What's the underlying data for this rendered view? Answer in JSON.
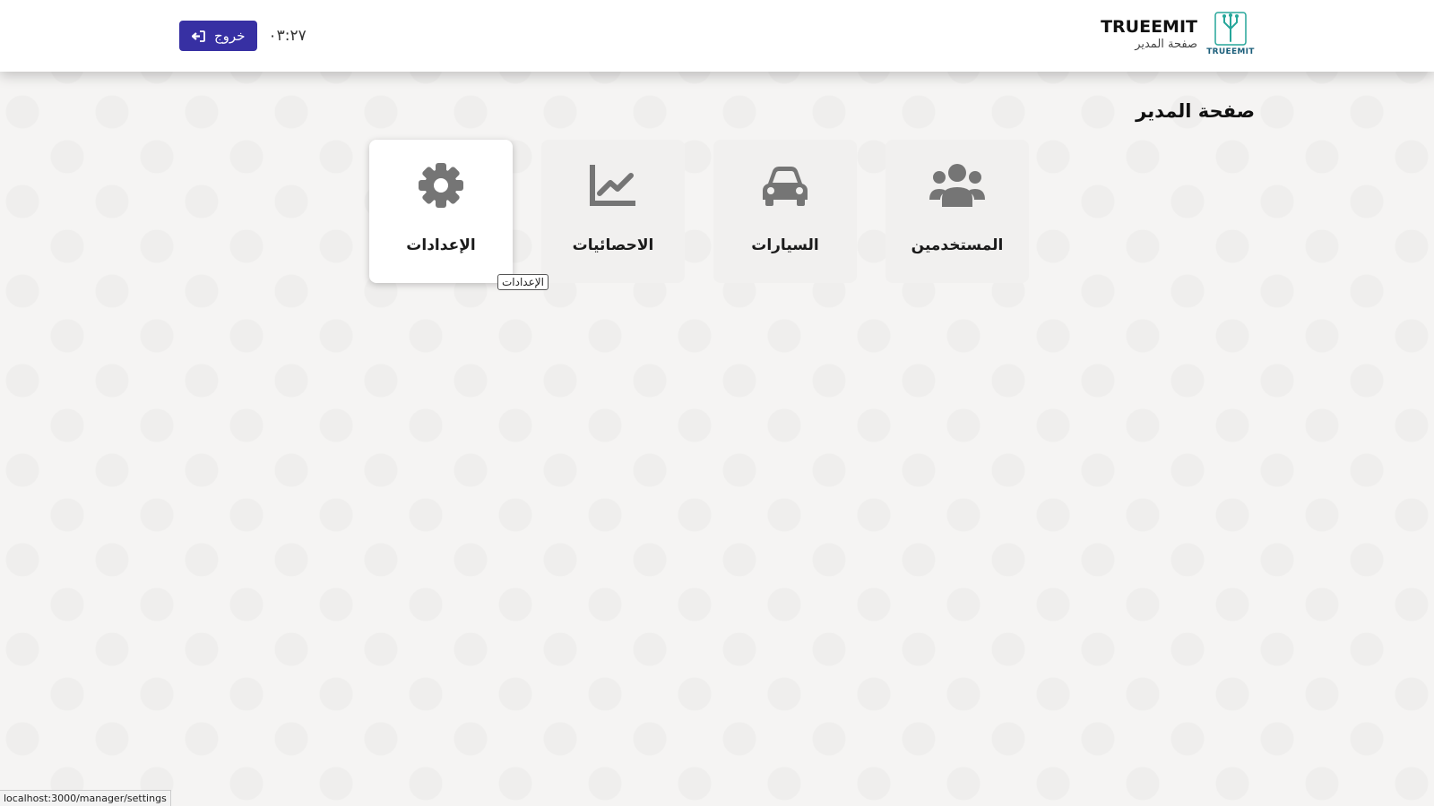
{
  "header": {
    "brand_name": "TRUEEMIT",
    "brand_subtitle": "صفحة المدير",
    "logo_text": "TRUEEMIT",
    "time": "٠٣:٢٧",
    "logout_label": "خروج"
  },
  "main": {
    "title": "صفحة المدير",
    "cards": [
      {
        "label": "المستخدمين",
        "icon": "users-icon"
      },
      {
        "label": "السيارات",
        "icon": "car-icon"
      },
      {
        "label": "الاحصائيات",
        "icon": "chart-line-icon"
      },
      {
        "label": "الإعدادات",
        "icon": "gear-icon"
      }
    ]
  },
  "tooltip": "الإعدادات",
  "status_bar": {
    "url": "localhost:3000/manager/settings"
  },
  "colors": {
    "accent": "#3730a3",
    "icon": "#757575",
    "logo": "#26a69a"
  }
}
